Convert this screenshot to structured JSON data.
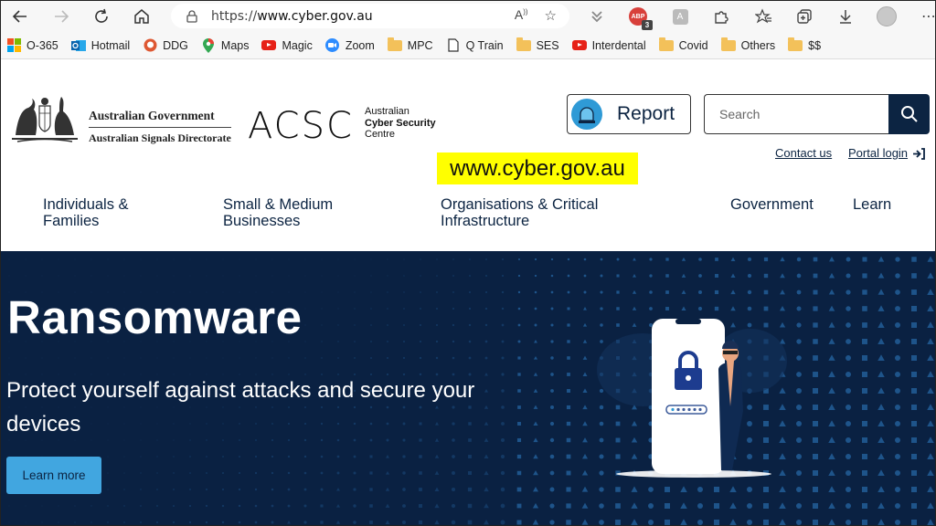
{
  "browser": {
    "url_scheme": "https://",
    "url_domain": "www.cyber.gov.au",
    "abp_badge": "ABP",
    "abp_count": "3"
  },
  "bookmarks": [
    {
      "label": "O-365",
      "icon": "office-icon"
    },
    {
      "label": "Hotmail",
      "icon": "outlook-icon"
    },
    {
      "label": "DDG",
      "icon": "duckduckgo-icon"
    },
    {
      "label": "Maps",
      "icon": "maps-pin-icon"
    },
    {
      "label": "Magic",
      "icon": "youtube-icon"
    },
    {
      "label": "Zoom",
      "icon": "zoom-icon"
    },
    {
      "label": "MPC",
      "icon": "folder-icon"
    },
    {
      "label": "Q Train",
      "icon": "page-icon"
    },
    {
      "label": "SES",
      "icon": "folder-icon"
    },
    {
      "label": "Interdental",
      "icon": "youtube-icon"
    },
    {
      "label": "Covid",
      "icon": "folder-icon"
    },
    {
      "label": "Others",
      "icon": "folder-icon"
    },
    {
      "label": "$$",
      "icon": "folder-icon"
    }
  ],
  "header": {
    "gov_line1": "Australian Government",
    "gov_line2": "Australian Signals Directorate",
    "acsc_logo": "ACSC",
    "acsc_sub1": "Australian",
    "acsc_sub2": "Cyber Security",
    "acsc_sub3": "Centre",
    "report_label": "Report",
    "search_placeholder": "Search",
    "contact_label": "Contact us",
    "portal_label": "Portal login",
    "highlight_text": "www.cyber.gov.au"
  },
  "nav": {
    "individuals_1": "Individuals &",
    "individuals_2": "Families",
    "smb_1": "Small & Medium",
    "smb_2": "Businesses",
    "org_1": "Organisations & Critical",
    "org_2": "Infrastructure",
    "government": "Government",
    "learn": "Learn"
  },
  "hero": {
    "title": "Ransomware",
    "subtitle_1": "Protect yourself against attacks and secure your",
    "subtitle_2": "devices",
    "button": "Learn more"
  },
  "colors": {
    "navy": "#0a2142",
    "accent_blue": "#41a6e0",
    "highlight_yellow": "#ffff00"
  }
}
